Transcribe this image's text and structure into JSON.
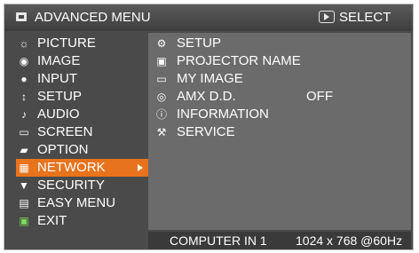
{
  "header": {
    "title": "ADVANCED MENU",
    "menu_icon": "menu-icon",
    "select_icon": "select-icon",
    "select_label": "SELECT"
  },
  "sidebar": {
    "items": [
      {
        "label": "PICTURE",
        "icon": "picture-icon"
      },
      {
        "label": "IMAGE",
        "icon": "image-icon"
      },
      {
        "label": "INPUT",
        "icon": "input-icon"
      },
      {
        "label": "SETUP",
        "icon": "setup-icon"
      },
      {
        "label": "AUDIO",
        "icon": "audio-icon"
      },
      {
        "label": "SCREEN",
        "icon": "screen-icon"
      },
      {
        "label": "OPTION",
        "icon": "option-icon"
      },
      {
        "label": "NETWORK",
        "icon": "network-icon",
        "active": true
      },
      {
        "label": "SECURITY",
        "icon": "security-icon"
      },
      {
        "label": "EASY MENU",
        "icon": "easy-menu-icon"
      },
      {
        "label": "EXIT",
        "icon": "exit-icon"
      }
    ]
  },
  "submenu": {
    "items": [
      {
        "label": "SETUP",
        "value": "",
        "icon": "network-setup-icon"
      },
      {
        "label": "PROJECTOR NAME",
        "value": "",
        "icon": "projector-name-icon"
      },
      {
        "label": "MY IMAGE",
        "value": "",
        "icon": "my-image-icon"
      },
      {
        "label": "AMX D.D.",
        "value": "OFF",
        "icon": "amx-icon"
      },
      {
        "label": "INFORMATION",
        "value": "",
        "icon": "information-icon"
      },
      {
        "label": "SERVICE",
        "value": "",
        "icon": "service-icon"
      }
    ]
  },
  "status": {
    "source": "COMPUTER IN 1",
    "resolution": "1024 x 768 @60Hz"
  },
  "colors": {
    "background": "#4a4a4a",
    "panel": "#6b6b6b",
    "active": "#e8731d",
    "text": "#ffffff"
  }
}
